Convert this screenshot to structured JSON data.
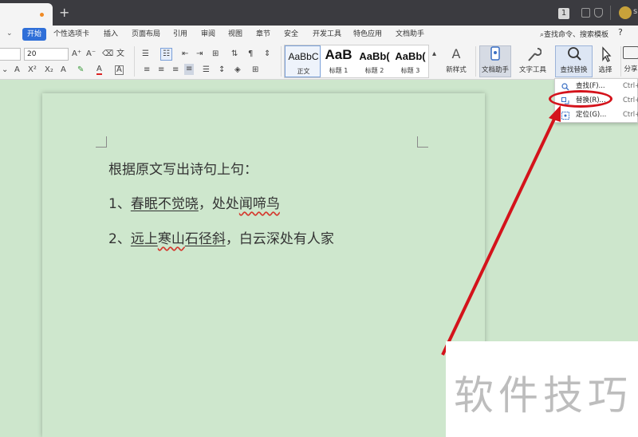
{
  "menu": {
    "items": [
      "开始",
      "个性选项卡",
      "插入",
      "页面布局",
      "引用",
      "审阅",
      "视图",
      "章节",
      "安全",
      "开发工具",
      "特色应用",
      "文档助手"
    ],
    "search": "查找命令、搜索模板",
    "help": "?"
  },
  "titlebar": {
    "badge": "1",
    "user": "si"
  },
  "ribbon": {
    "font_size": "20",
    "styles": [
      {
        "sample": "AaBbC",
        "label": "正文"
      },
      {
        "sample": "AaB",
        "label": "标题 1"
      },
      {
        "sample": "AaBb(",
        "label": "标题 2"
      },
      {
        "sample": "AaBb(",
        "label": "标题 3"
      }
    ],
    "new_style": "新样式",
    "doc_assistant": "文档助手",
    "text_tools": "文字工具",
    "find_replace": "查找替换",
    "select": "选择",
    "share": "分享"
  },
  "dropdown": {
    "items": [
      {
        "label": "查找(F)...",
        "shortcut": "Ctrl+"
      },
      {
        "label": "替换(R)...",
        "shortcut": "Ctrl+H"
      },
      {
        "label": "定位(G)...",
        "shortcut": "Ctrl+"
      }
    ]
  },
  "document": {
    "heading": "根据原文写出诗句上句：",
    "line1_prefix": "1、",
    "line1_answer": "春眠不觉晓",
    "line1_rest": "，处处",
    "line1_wavy": "闻啼鸟",
    "line2_prefix": "2、",
    "line2_answer_a": "远上",
    "line2_answer_b": "寒山",
    "line2_answer_c": "石径斜",
    "line2_rest": "，白云深处有人家"
  },
  "watermark": "软件技巧",
  "colors": {
    "accent": "#2f6fd8",
    "highlight": "#d4131b",
    "page": "#cee7cd"
  }
}
